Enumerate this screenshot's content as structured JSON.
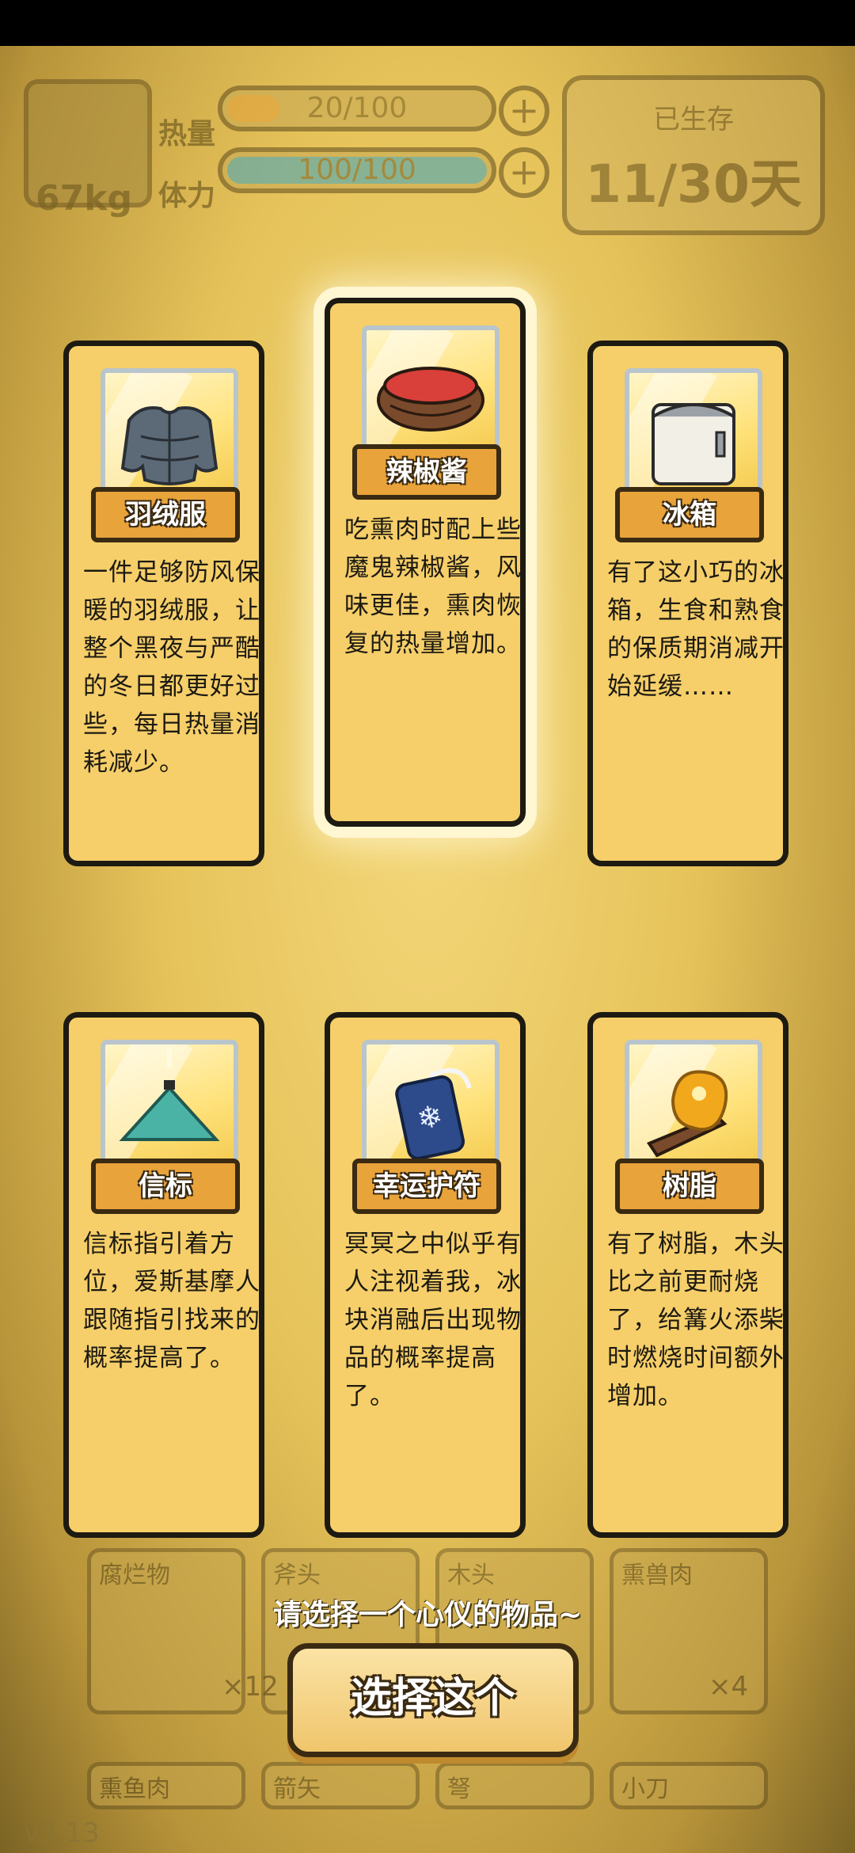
{
  "hud": {
    "weight": "67kg",
    "heat_label": "热量",
    "heat_value": "20/100",
    "heat_fraction": 0.2,
    "stamina_label": "体力",
    "stamina_value": "100/100",
    "stamina_fraction": 1.0,
    "survive_title": "已生存",
    "survive_days": "11/30天",
    "version": "v3.13"
  },
  "cards": [
    {
      "name": "羽绒服",
      "icon": "down-jacket-icon",
      "desc": "一件足够防风保暖的羽绒服，让整个黑夜与严酷的冬日都更好过些，每日热量消耗减少。",
      "selected": false
    },
    {
      "name": "辣椒酱",
      "icon": "chili-sauce-icon",
      "desc": "吃熏肉时配上些魔鬼辣椒酱，风味更佳，熏肉恢复的热量增加。",
      "selected": true
    },
    {
      "name": "冰箱",
      "icon": "fridge-icon",
      "desc": "有了这小巧的冰箱，生食和熟食的保质期消减开始延缓……",
      "selected": false
    },
    {
      "name": "信标",
      "icon": "beacon-icon",
      "desc": "信标指引着方位，爱斯基摩人跟随指引找来的概率提高了。",
      "selected": false
    },
    {
      "name": "幸运护符",
      "icon": "lucky-charm-icon",
      "desc": "冥冥之中似乎有人注视着我，冰块消融后出现物品的概率提高了。",
      "selected": false
    },
    {
      "name": "树脂",
      "icon": "resin-icon",
      "desc": "有了树脂，木头比之前更耐烧了，给篝火添柴时燃烧时间额外增加。",
      "selected": false
    }
  ],
  "inventory": {
    "slots": [
      {
        "label": "腐烂物",
        "count": "×12"
      },
      {
        "label": "斧头",
        "count": ""
      },
      {
        "label": "木头",
        "count": ""
      },
      {
        "label": "熏兽肉",
        "count": "×4"
      },
      {
        "label": "熏鱼肉",
        "count": ""
      },
      {
        "label": "箭矢",
        "count": ""
      },
      {
        "label": "弩",
        "count": ""
      },
      {
        "label": "小刀",
        "count": ""
      }
    ]
  },
  "prompt": "请选择一个心仪的物品~",
  "choose_button": "选择这个",
  "colors": {
    "card_bg": "#f6cf6a",
    "plate": "#e8a33a",
    "outline": "#1d1a12"
  }
}
